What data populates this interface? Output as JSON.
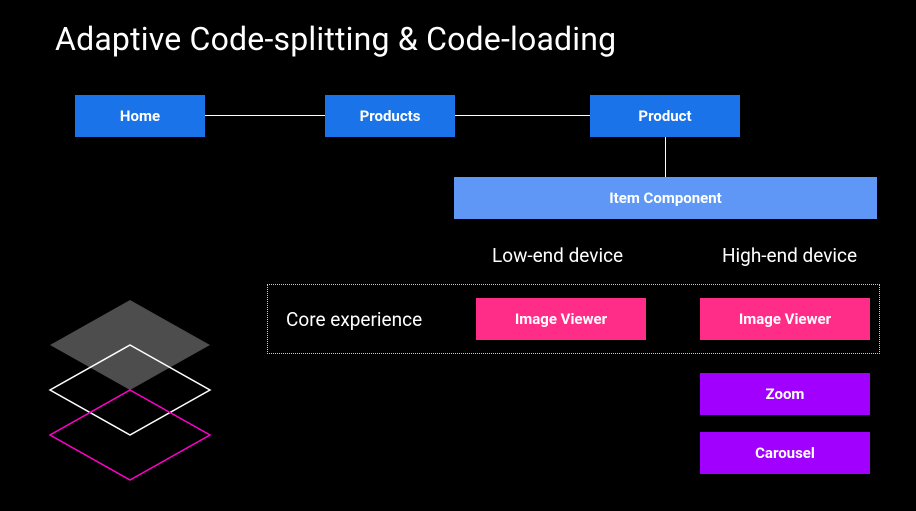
{
  "title": "Adaptive Code-splitting & Code-loading",
  "nodes": {
    "home": "Home",
    "products": "Products",
    "product": "Product",
    "item_component": "Item Component"
  },
  "labels": {
    "low_end": "Low-end device",
    "high_end": "High-end device",
    "core_experience": "Core experience"
  },
  "modules": {
    "image_viewer_low": "Image Viewer",
    "image_viewer_high": "Image Viewer",
    "zoom": "Zoom",
    "carousel": "Carousel"
  }
}
